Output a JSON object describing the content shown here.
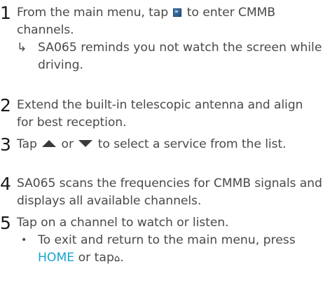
{
  "steps": [
    {
      "number": "1",
      "text_before_icon": "From the main menu, tap",
      "icon": "cmmb-app-icon",
      "text_after_icon": "to enter CMMB channels.",
      "result": {
        "marker": "↳",
        "text": "SA065 reminds you not watch the screen while driving."
      }
    },
    {
      "number": "2",
      "text": "Extend the built-in telescopic antenna and align for best reception."
    },
    {
      "number": "3",
      "text_part1": "Tap",
      "icon_up": "triangle-up-icon",
      "text_part2": "or",
      "icon_down": "triangle-down-icon",
      "text_part3": "to select a service from the list."
    },
    {
      "number": "4",
      "text": "SA065 scans the frequencies for CMMB signals and displays all available channels."
    },
    {
      "number": "5",
      "text": "Tap on a channel to watch or listen.",
      "bullet": {
        "marker": "•",
        "text_part1": "To exit and return to the main menu, press",
        "highlight": "HOME",
        "text_part2": "or tap",
        "icon": "home-icon",
        "text_part3": "."
      }
    }
  ],
  "colors": {
    "body_text": "#4a4a4a",
    "step_number": "#1a1a1a",
    "highlight": "#19a3d4"
  }
}
